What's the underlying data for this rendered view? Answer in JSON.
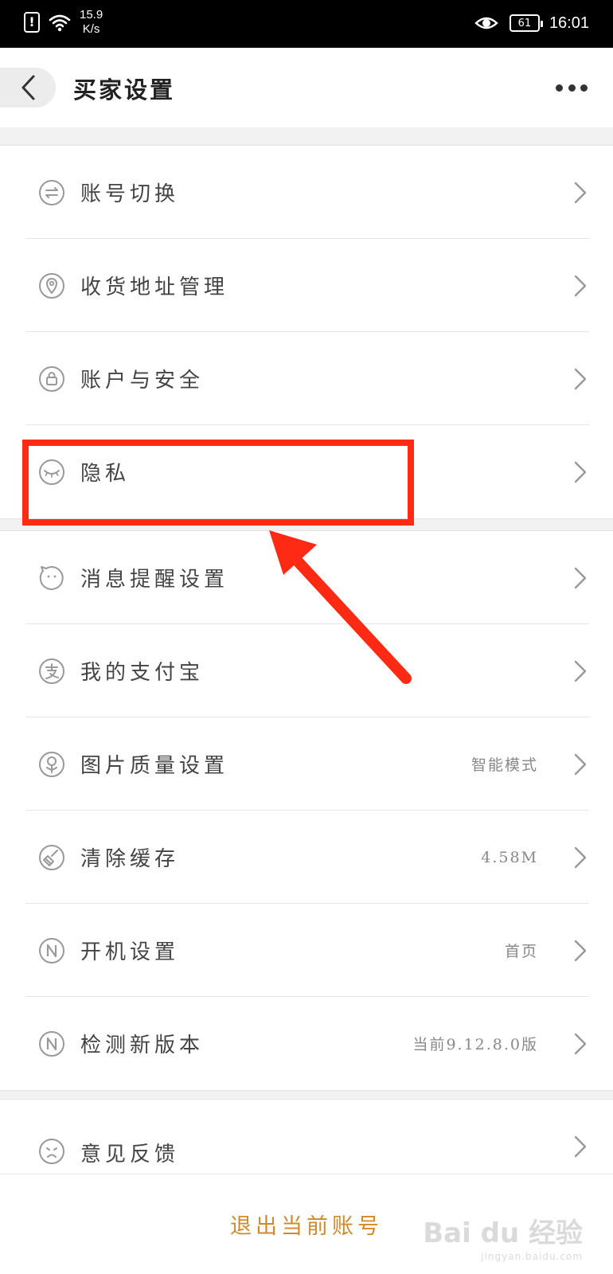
{
  "status_bar": {
    "alert": "!",
    "network_speed_value": "15.9",
    "network_speed_unit": "K/s",
    "battery": "61",
    "time": "16:01"
  },
  "header": {
    "title": "买家设置"
  },
  "groups": [
    {
      "items": [
        {
          "label": "账号切换",
          "icon": "switch-icon",
          "value": ""
        },
        {
          "label": "收货地址管理",
          "icon": "location-pin-icon",
          "value": ""
        },
        {
          "label": "账户与安全",
          "icon": "lock-icon",
          "value": ""
        },
        {
          "label": "隐私",
          "icon": "closed-eye-icon",
          "value": ""
        }
      ]
    },
    {
      "items": [
        {
          "label": "消息提醒设置",
          "icon": "chat-bubble-icon",
          "value": ""
        },
        {
          "label": "我的支付宝",
          "icon": "alipay-icon",
          "value": ""
        },
        {
          "label": "图片质量设置",
          "icon": "image-quality-icon",
          "value": "智能模式"
        },
        {
          "label": "清除缓存",
          "icon": "broom-icon",
          "value": "4.58M"
        },
        {
          "label": "开机设置",
          "icon": "n-circle-icon",
          "value": "首页"
        },
        {
          "label": "检测新版本",
          "icon": "n-circle-icon",
          "value": "当前9.12.8.0版"
        }
      ]
    },
    {
      "items": [
        {
          "label": "意见反馈",
          "icon": "sad-face-icon",
          "value": ""
        }
      ]
    }
  ],
  "footer": {
    "logout_label": "退出当前账号"
  },
  "watermark": {
    "text": "Bai du 经验",
    "url": "jingyan.baidu.com"
  },
  "colors": {
    "accent": "#d08a2c",
    "annotation": "#ff2a14"
  }
}
